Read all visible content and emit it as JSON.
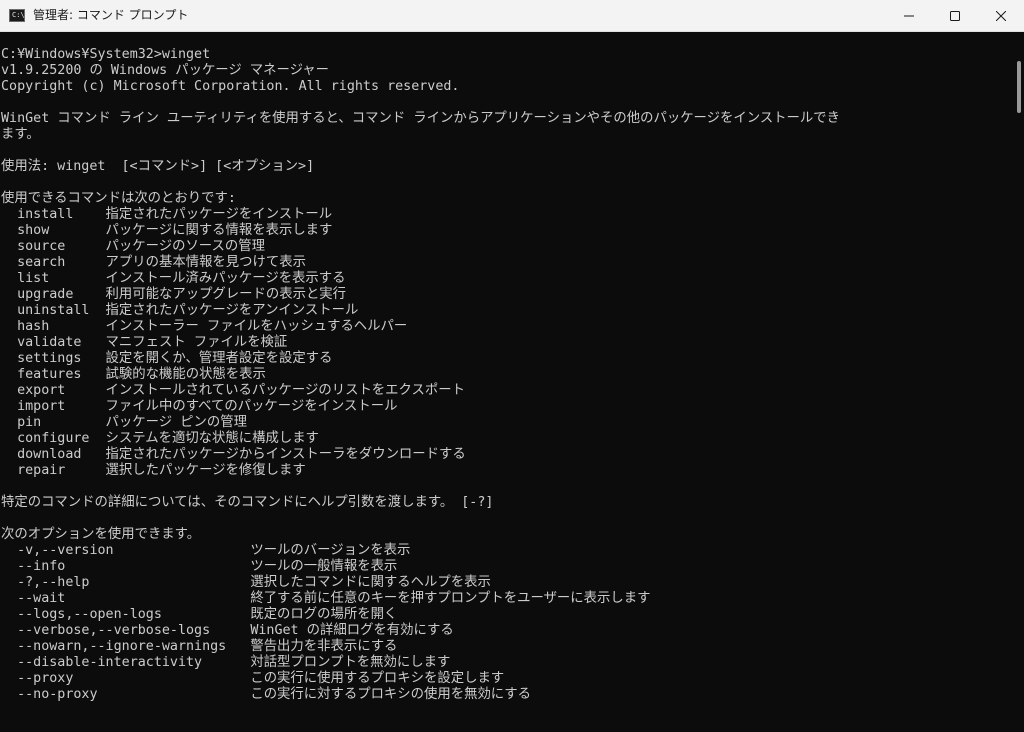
{
  "window": {
    "title": "管理者: コマンド プロンプト",
    "icon": "cmd-icon",
    "icon_glyph": "C:\\",
    "controls": {
      "minimize": "minimize-icon",
      "maximize": "maximize-icon",
      "close": "close-icon"
    }
  },
  "console": {
    "text_color": "#cccccc",
    "background_color": "#0c0c0c",
    "lines": [
      "C:¥Windows¥System32>winget",
      "v1.9.25200 の Windows パッケージ マネージャー",
      "Copyright (c) Microsoft Corporation. All rights reserved.",
      "",
      "WinGet コマンド ライン ユーティリティを使用すると、コマンド ラインからアプリケーションやその他のパッケージをインストールでき",
      "ます。",
      "",
      "使用法: winget  [<コマンド>] [<オプション>]",
      "",
      "使用できるコマンドは次のとおりです:",
      "  install    指定されたパッケージをインストール",
      "  show       パッケージに関する情報を表示します",
      "  source     パッケージのソースの管理",
      "  search     アプリの基本情報を見つけて表示",
      "  list       インストール済みパッケージを表示する",
      "  upgrade    利用可能なアップグレードの表示と実行",
      "  uninstall  指定されたパッケージをアンインストール",
      "  hash       インストーラー ファイルをハッシュするヘルパー",
      "  validate   マニフェスト ファイルを検証",
      "  settings   設定を開くか、管理者設定を設定する",
      "  features   試験的な機能の状態を表示",
      "  export     インストールされているパッケージのリストをエクスポート",
      "  import     ファイル中のすべてのパッケージをインストール",
      "  pin        パッケージ ピンの管理",
      "  configure  システムを適切な状態に構成します",
      "  download   指定されたパッケージからインストーラをダウンロードする",
      "  repair     選択したパッケージを修復します",
      "",
      "特定のコマンドの詳細については、そのコマンドにヘルプ引数を渡します。 [-?]",
      "",
      "次のオプションを使用できます。",
      "  -v,--version                 ツールのバージョンを表示",
      "  --info                       ツールの一般情報を表示",
      "  -?,--help                    選択したコマンドに関するヘルプを表示",
      "  --wait                       終了する前に任意のキーを押すプロンプトをユーザーに表示します",
      "  --logs,--open-logs           既定のログの場所を開く",
      "  --verbose,--verbose-logs     WinGet の詳細ログを有効にする",
      "  --nowarn,--ignore-warnings   警告出力を非表示にする",
      "  --disable-interactivity      対話型プロンプトを無効にします",
      "  --proxy                      この実行に使用するプロキシを設定します",
      "  --no-proxy                   この実行に対するプロキシの使用を無効にする"
    ]
  }
}
